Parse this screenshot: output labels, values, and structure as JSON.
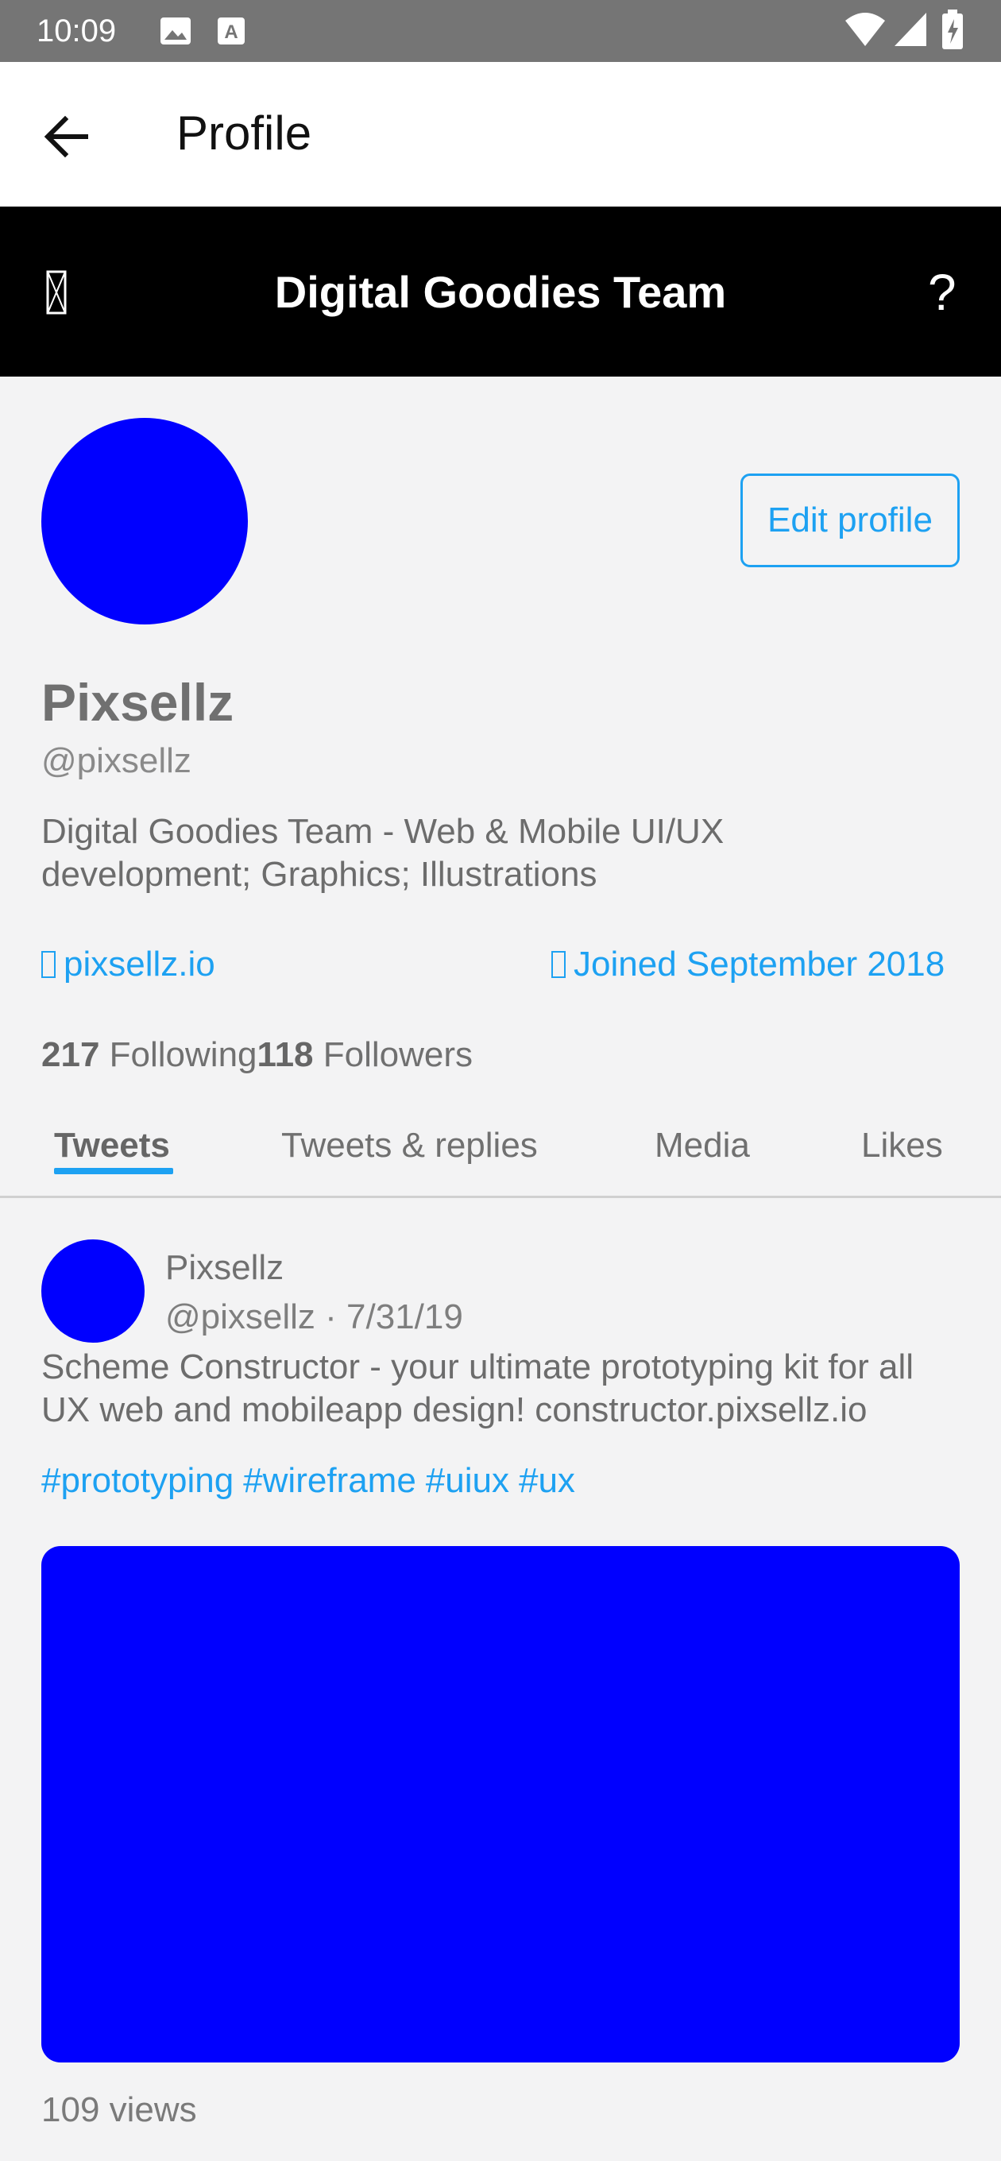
{
  "status_bar": {
    "time": "10:09",
    "left_icons": [
      "image-icon",
      "text-a-icon"
    ],
    "right_icons": [
      "wifi-icon",
      "signal-icon",
      "battery-charging-icon"
    ]
  },
  "app_bar": {
    "title": "Profile",
    "back_icon": "arrow-left-icon"
  },
  "header": {
    "title": "Digital Goodies Team",
    "left_icon": "missing-glyph-icon",
    "right_text": "?"
  },
  "profile": {
    "edit_button": "Edit profile",
    "name": "Pixsellz",
    "handle": "@pixsellz",
    "bio": "Digital Goodies Team - Web & Mobile UI/UX development; Graphics; Illustrations",
    "website": "pixsellz.io",
    "joined": "Joined September 2018",
    "following_count": "217",
    "following_label": "Following",
    "followers_count": "118",
    "followers_label": "Followers"
  },
  "tabs": [
    {
      "label": "Tweets",
      "active": true
    },
    {
      "label": "Tweets & replies",
      "active": false
    },
    {
      "label": "Media",
      "active": false
    },
    {
      "label": "Likes",
      "active": false
    }
  ],
  "tweet": {
    "name": "Pixsellz",
    "meta": "@pixsellz · 7/31/19",
    "text": "Scheme Constructor - your ultimate prototyping kit for all UX web and mobileapp design! constructor.pixsellz.io",
    "hashtags": [
      "#prototyping",
      "#wireframe",
      "#uiux",
      "#ux"
    ],
    "views": "109 views"
  },
  "colors": {
    "status_bar": "#757575",
    "header_bg": "#000000",
    "accent": "#1da1f2",
    "avatar": "#0000ff",
    "page_bg": "#f3f3f4"
  }
}
